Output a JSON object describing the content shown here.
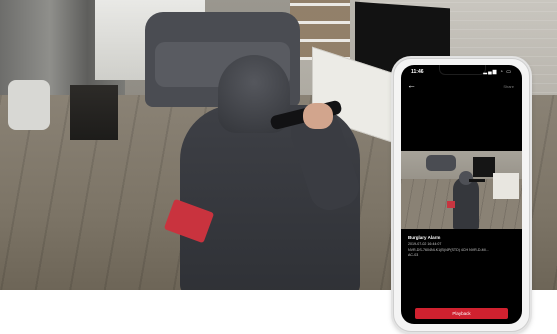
{
  "phone": {
    "status_time": "11:46",
    "status_icons": "▂▄▆ ◔ ▭",
    "back_arrow": "←",
    "share_label": "Share",
    "alarm_title": "Burglary Alarm",
    "alarm_time": "2019-07-02 16:44:07",
    "alarm_device": "NVR-DS-7604NI-K1(B)/4P(STD) 4CH NVR-D-MI...",
    "alarm_device_line2": "AC-03",
    "playback_label": "Playback"
  },
  "colors": {
    "playback_button": "#d0212f",
    "phone_screen": "#000000",
    "phone_frame": "#f4f4f4"
  },
  "icons": {
    "back": "arrow-left-icon",
    "status": "signal-wifi-battery-icon"
  }
}
